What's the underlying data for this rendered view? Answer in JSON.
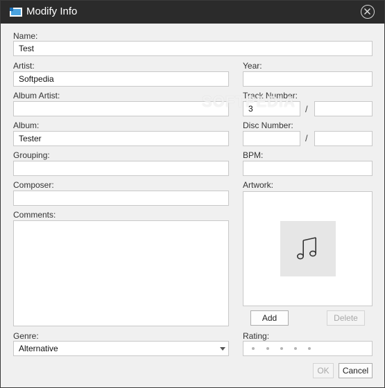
{
  "window": {
    "title": "Modify Info",
    "icon": "window-app-icon",
    "close_icon": "close-icon"
  },
  "watermark": "SOFTPEDIA",
  "fields": {
    "name": {
      "label": "Name:",
      "value": "Test"
    },
    "artist": {
      "label": "Artist:",
      "value": "Softpedia"
    },
    "album_artist": {
      "label": "Album Artist:",
      "value": ""
    },
    "album": {
      "label": "Album:",
      "value": "Tester"
    },
    "grouping": {
      "label": "Grouping:",
      "value": ""
    },
    "composer": {
      "label": "Composer:",
      "value": ""
    },
    "comments": {
      "label": "Comments:",
      "value": ""
    },
    "genre": {
      "label": "Genre:",
      "value": "Alternative"
    },
    "year": {
      "label": "Year:",
      "value": ""
    },
    "track": {
      "label": "Track Number:",
      "value": "3",
      "of": "",
      "separator": "/"
    },
    "disc": {
      "label": "Disc Number:",
      "value": "",
      "of": "",
      "separator": "/"
    },
    "bpm": {
      "label": "BPM:",
      "value": ""
    },
    "artwork": {
      "label": "Artwork:",
      "placeholder_icon": "music-note-icon"
    },
    "rating": {
      "label": "Rating:",
      "stars": 0,
      "max": 5
    }
  },
  "buttons": {
    "add": "Add",
    "delete": "Delete",
    "ok": "OK",
    "cancel": "Cancel"
  }
}
